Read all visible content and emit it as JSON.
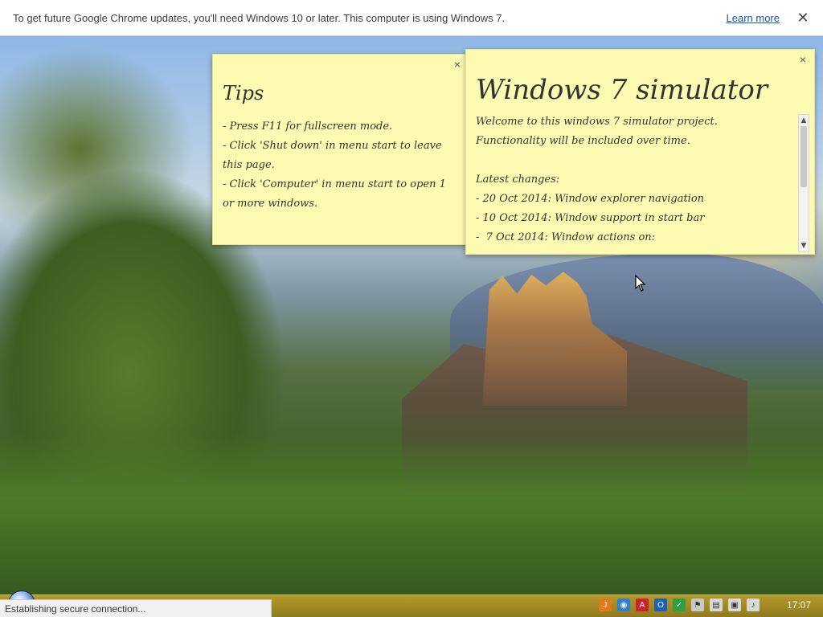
{
  "infobar": {
    "message": "To get future Google Chrome updates, you'll need Windows 10 or later. This computer is using Windows 7.",
    "learn_more": "Learn more",
    "close_glyph": "✕"
  },
  "tips_note": {
    "title": "Tips",
    "close_glyph": "×",
    "lines": [
      "- Press F11 for fullscreen mode.",
      "- Click 'Shut down' in menu start to leave",
      "this page.",
      "- Click 'Computer' in menu start to open 1",
      "or more windows."
    ]
  },
  "sim_note": {
    "title": "Windows 7 simulator",
    "close_glyph": "×",
    "lines": [
      "Welcome to this windows 7 simulator project.",
      "Functionality will be included over time.",
      "",
      "Latest changes:",
      "- 20 Oct 2014: Window explorer navigation",
      "- 10 Oct 2014: Window support in start bar",
      "-  7 Oct 2014: Window actions on:"
    ],
    "scroll_up": "▲",
    "scroll_down": "▼"
  },
  "status_bar": {
    "text": "Establishing secure connection..."
  },
  "taskbar": {
    "clock": "17:07",
    "tray_icons": [
      {
        "name": "java-icon",
        "color": "#e07a1c",
        "glyph": "J"
      },
      {
        "name": "network-globe-icon",
        "color": "#2e7fcf",
        "glyph": "◉"
      },
      {
        "name": "pdf-icon",
        "color": "#d0202a",
        "glyph": "A"
      },
      {
        "name": "outlook-icon",
        "color": "#1c5fb8",
        "glyph": "O"
      },
      {
        "name": "security-shield-icon",
        "color": "#2ea043",
        "glyph": "✓"
      },
      {
        "name": "flag-icon",
        "color": "#c8c8c8",
        "glyph": "⚑"
      },
      {
        "name": "clipboard-icon",
        "color": "#d8d8d8",
        "glyph": "▤"
      },
      {
        "name": "network-icon",
        "color": "#d8d8d8",
        "glyph": "▣"
      },
      {
        "name": "volume-icon",
        "color": "#d8d8d8",
        "glyph": "♪"
      }
    ]
  }
}
